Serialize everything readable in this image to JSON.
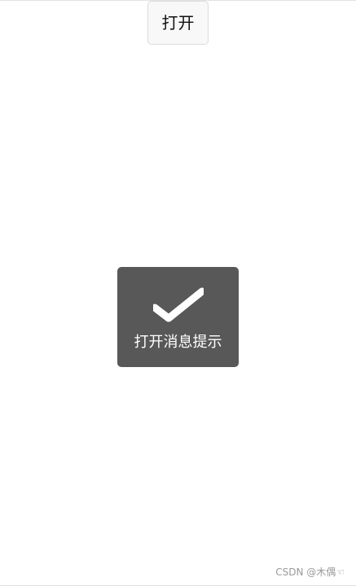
{
  "open_button": {
    "label": "打开"
  },
  "toast": {
    "icon": "check-icon",
    "message": "打开消息提示",
    "background_color": "#585858"
  },
  "watermark": {
    "text": "CSDN @木偶☜"
  }
}
